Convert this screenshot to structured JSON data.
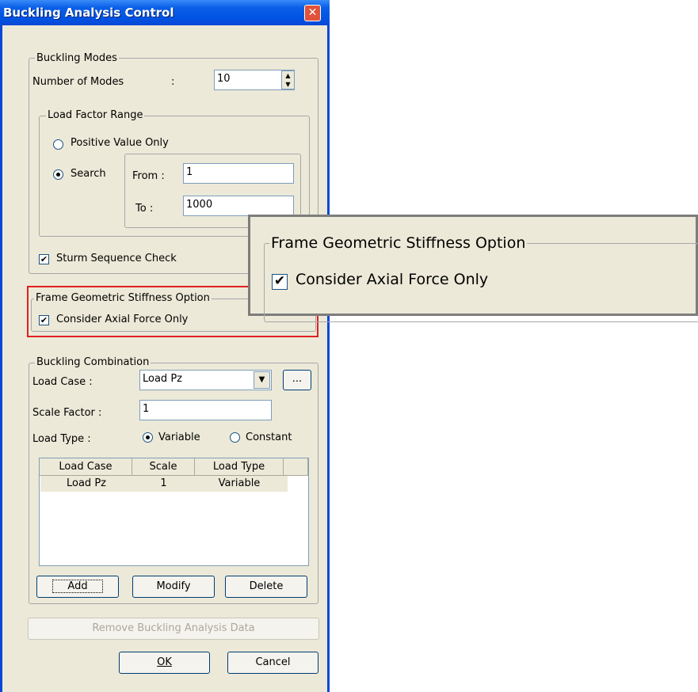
{
  "window": {
    "title": "Buckling Analysis Control",
    "close_label": "✕"
  },
  "buckling_modes": {
    "legend": "Buckling Modes",
    "num_modes_label": "Number of Modes",
    "colon": ":",
    "num_modes_value": "10"
  },
  "load_factor_range": {
    "legend": "Load Factor Range",
    "positive_label": "Positive Value Only",
    "search_label": "Search",
    "selected": "Search",
    "from_label": "From :",
    "from_value": "1",
    "to_label": "To :",
    "to_value": "1000"
  },
  "sturm": {
    "label": "Sturm Sequence Check",
    "checked": true
  },
  "frame_stiffness": {
    "legend": "Frame Geometric Stiffness Option",
    "axial_label": "Consider Axial Force Only",
    "checked": true,
    "highlight_color": "#e02020"
  },
  "buckling_combination": {
    "legend": "Buckling Combination",
    "load_case_label": "Load Case :",
    "load_case_value": "Load Pz",
    "browse_label": "...",
    "scale_factor_label": "Scale Factor :",
    "scale_factor_value": "1",
    "load_type_label": "Load Type :",
    "variable_label": "Variable",
    "constant_label": "Constant",
    "load_type_selected": "Variable",
    "table": {
      "headers": [
        "Load Case",
        "Scale",
        "Load Type"
      ],
      "rows": [
        [
          "Load Pz",
          "1",
          "Variable"
        ]
      ]
    },
    "add_label": "Add",
    "modify_label": "Modify",
    "delete_label": "Delete"
  },
  "footer": {
    "remove_label": "Remove Buckling Analysis Data",
    "ok_label": "OK",
    "cancel_label": "Cancel"
  },
  "zoom_callout": {
    "legend": "Frame Geometric Stiffness Option",
    "axial_label": "Consider Axial Force Only"
  }
}
